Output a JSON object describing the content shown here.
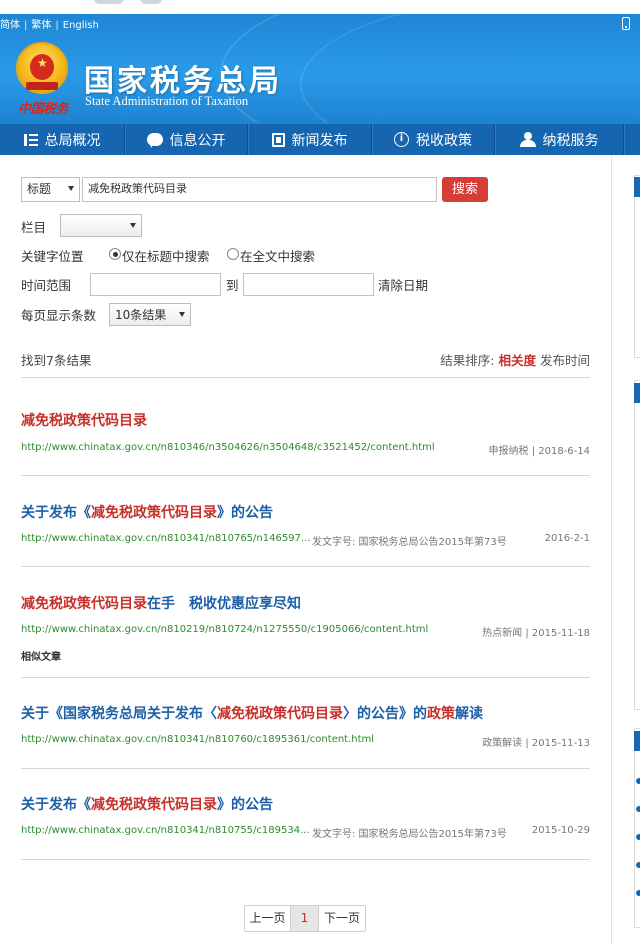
{
  "header": {
    "lang_simplified": "简体",
    "lang_traditional": "繁体",
    "lang_english": "English",
    "title_cn": "国家税务总局",
    "title_en": "State Administration of Taxation",
    "slogan": "中国税务"
  },
  "nav": {
    "items": [
      {
        "label": "总局概况",
        "icon": "menu-list-icon"
      },
      {
        "label": "信息公开",
        "icon": "chat-bubble-icon"
      },
      {
        "label": "新闻发布",
        "icon": "document-icon"
      },
      {
        "label": "税收政策",
        "icon": "info-icon"
      },
      {
        "label": "纳税服务",
        "icon": "user-icon"
      }
    ]
  },
  "search": {
    "field_select": "标题",
    "query": "减免税政策代码目录",
    "button": "搜索",
    "column_label": "栏目",
    "column_value": "",
    "keyword_position_label": "关键字位置",
    "radio_title_only": "仅在标题中搜索",
    "radio_fulltext": "在全文中搜索",
    "radio_selected": "title_only",
    "date_range_label": "时间范围",
    "date_to": "到",
    "date_clear": "清除日期",
    "per_page_label": "每页显示条数",
    "per_page_value": "10条结果"
  },
  "results_header": {
    "count": "找到7条结果",
    "sort_label": "结果排序:",
    "sort_relevance": "相关度",
    "sort_date": "发布时间"
  },
  "results": [
    {
      "title_parts": [
        {
          "t": "减免税政策代码目录",
          "hl": true
        }
      ],
      "url": "http://www.chinatax.gov.cn/n810346/n3504626/n3504648/c3521452/content.html",
      "meta": "",
      "date": "申报纳税 | 2018-6-14"
    },
    {
      "title_parts": [
        {
          "t": "关于发布《",
          "hl": false
        },
        {
          "t": "减免税政策代码目录",
          "hl": true
        },
        {
          "t": "》的公告",
          "hl": false
        }
      ],
      "url": "http://www.chinatax.gov.cn/n810341/n810765/n146597...",
      "meta": "发文字号: 国家税务总局公告2015年第73号",
      "date": "2016-2-1"
    },
    {
      "title_parts": [
        {
          "t": "减免税政策代码目录",
          "hl": true
        },
        {
          "t": "在手　税收优惠应享尽知",
          "hl": false
        }
      ],
      "url": "http://www.chinatax.gov.cn/n810219/n810724/n1275550/c1905066/content.html",
      "meta": "",
      "date": "热点新闻 | 2015-11-18",
      "similar": "相似文章"
    },
    {
      "title_parts": [
        {
          "t": "关于《国家税务总局关于发布〈",
          "hl": false
        },
        {
          "t": "减免税政策代码目录",
          "hl": true
        },
        {
          "t": "〉的公告》的",
          "hl": false
        },
        {
          "t": "政策",
          "hl": true
        },
        {
          "t": "解读",
          "hl": false
        }
      ],
      "url": "http://www.chinatax.gov.cn/n810341/n810760/c1895361/content.html",
      "meta": "",
      "date": "政策解读 | 2015-11-13"
    },
    {
      "title_parts": [
        {
          "t": "关于发布《",
          "hl": false
        },
        {
          "t": "减免税政策代码目录",
          "hl": true
        },
        {
          "t": "》的公告",
          "hl": false
        }
      ],
      "url": "http://www.chinatax.gov.cn/n810341/n810755/c189534...",
      "meta": "发文字号: 国家税务总局公告2015年第73号",
      "date": "2015-10-29"
    }
  ],
  "pager": {
    "prev": "上一页",
    "current": "1",
    "next": "下一页"
  }
}
